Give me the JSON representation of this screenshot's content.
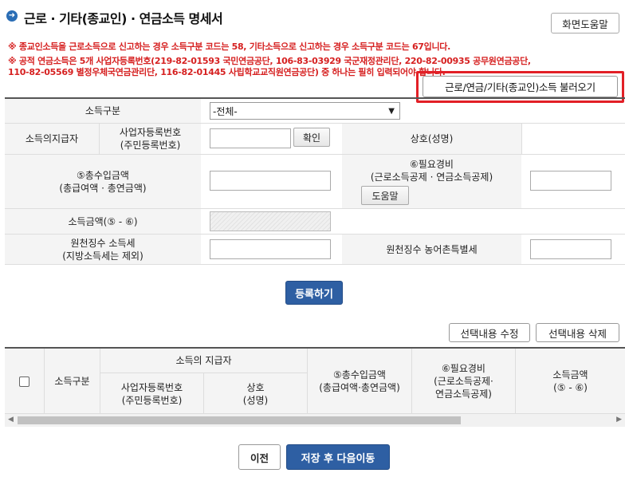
{
  "header": {
    "icon": "arrow-right-icon",
    "title": "근로 · 기타(종교인) · 연금소득 명세서",
    "help_button": "화면도움말"
  },
  "notices": [
    "※ 종교인소득을 근로소득으로 신고하는 경우 소득구분 코드는 58, 기타소득으로 신고하는 경우 소득구분 코드는 67입니다.",
    "※ 공적 연금소득은 5개 사업자등록번호(219-82-01593 국민연금공단, 106-83-03929 국군재정관리단, 220-82-00935 공무원연금공단,",
    "110-82-05569 별정우체국연금관리단, 116-82-01445 사립학교교직원연금공단) 중 하나는 필히 입력되어야 합니다."
  ],
  "load_button": "근로/연금/기타(종교인)소득 불러오기",
  "form": {
    "income_type_label": "소득구분",
    "income_type_value": "-전체-",
    "payer_label": "소득의지급자",
    "bizno_label_1": "사업자등록번호",
    "bizno_label_2": "(주민등록번호)",
    "confirm_button": "확인",
    "company_label": "상호(성명)",
    "total_income_label_1": "⑤총수입금액",
    "total_income_label_2": "(총급여액 · 총연금액)",
    "expense_label_1": "⑥필요경비",
    "expense_label_2": "(근로소득공제 · 연금소득공제)",
    "expense_help_button": "도움말",
    "income_amount_label": "소득금액(⑤ - ⑥)",
    "withholding_tax_label_1": "원천징수 소득세",
    "withholding_tax_label_2": "(지방소득세는 제외)",
    "rural_tax_label": "원천징수 농어촌특별세"
  },
  "register_button": "등록하기",
  "grid_actions": {
    "edit": "선택내용 수정",
    "delete": "선택내용 삭제"
  },
  "grid": {
    "col_type": "소득구분",
    "col_payer": "소득의 지급자",
    "col_bizno_1": "사업자등록번호",
    "col_bizno_2": "(주민등록번호)",
    "col_name_1": "상호",
    "col_name_2": "(성명)",
    "col_total_1": "⑤총수입금액",
    "col_total_2": "(총급여액·총연금액)",
    "col_expense_1": "⑥필요경비",
    "col_expense_2": "(근로소득공제·",
    "col_expense_3": "연금소득공제)",
    "col_income_1": "소득금액",
    "col_income_2": "(⑤ - ⑥)"
  },
  "footer": {
    "prev_button": "이전",
    "next_button": "저장 후 다음이동"
  }
}
